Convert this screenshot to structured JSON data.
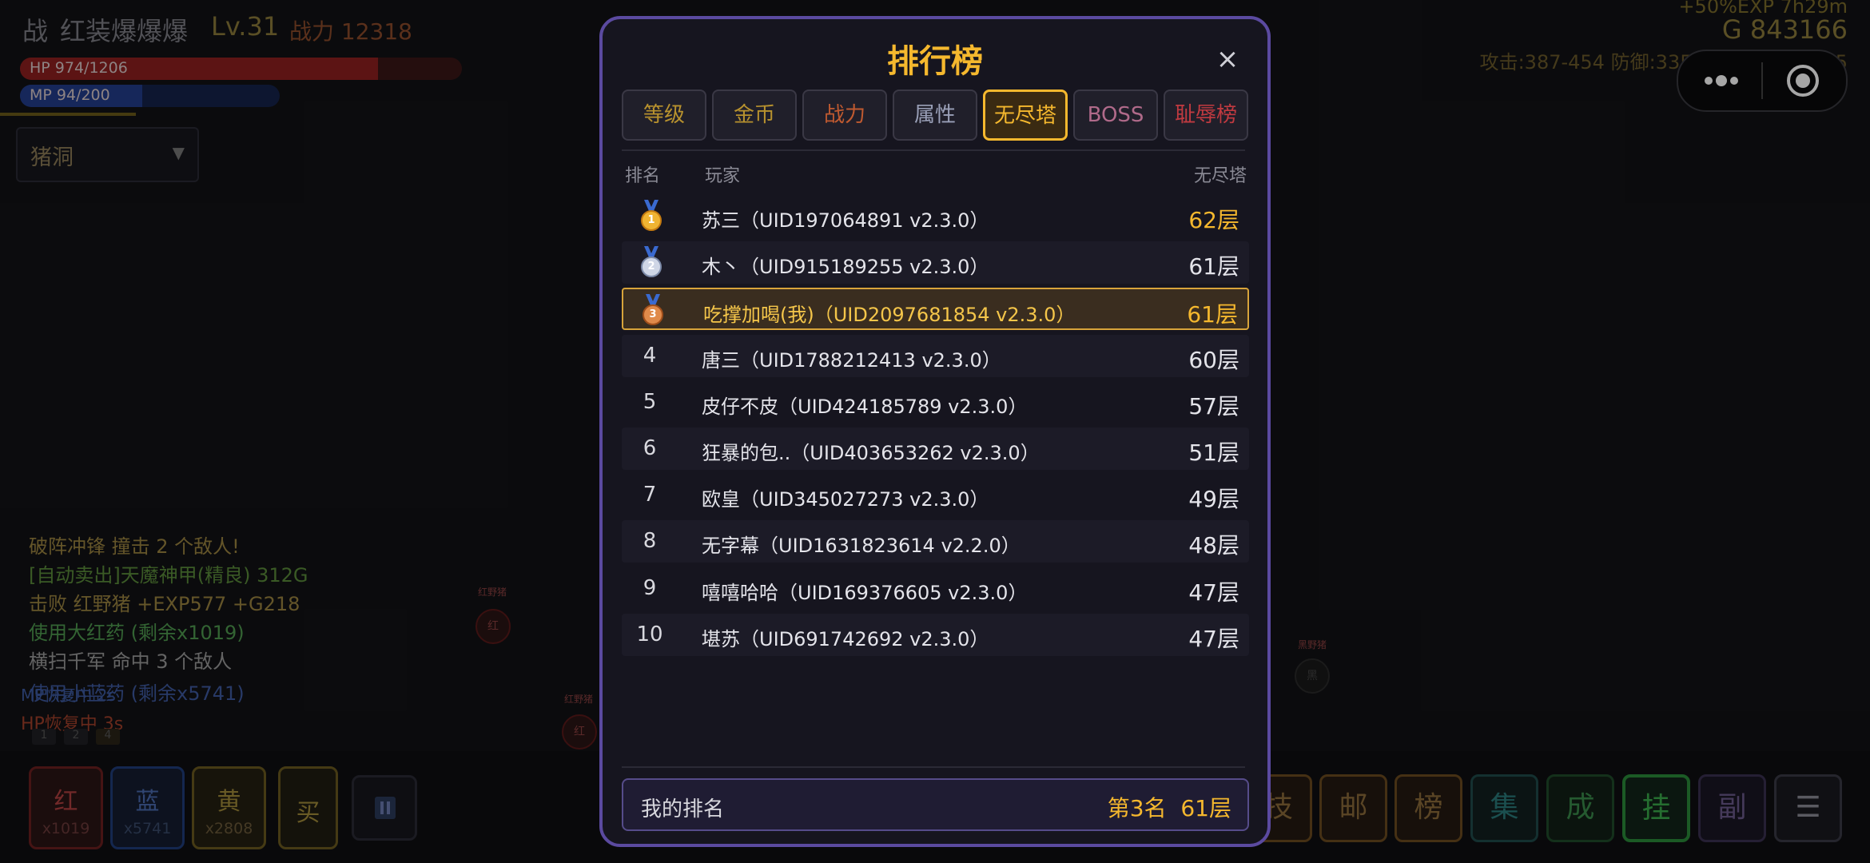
{
  "player": {
    "class_icon": "战",
    "name": "红装爆爆爆",
    "level": "Lv.31",
    "power": "战力 12318",
    "hp": "HP 974/1206",
    "hp_fraction": 0.81,
    "mp": "MP 94/200",
    "mp_fraction": 0.47
  },
  "top_right": {
    "exp_bonus": "+50%EXP 7h29m",
    "gold": "G 843166",
    "stats": "攻击:387-454 防御:335-389 魔御:1..165"
  },
  "zone": {
    "value": "猪洞",
    "arrow": "▼"
  },
  "combat_log": [
    {
      "text": "破阵冲锋 撞击 2 个敌人!",
      "color": "#9a8340"
    },
    {
      "text": "[自动卖出]天魔神甲(精良) 312G",
      "color": "#5a8a3a"
    },
    {
      "text": "击败 红野猪 +EXP577 +G218",
      "color": "#9a8340"
    },
    {
      "text": "使用大红药 (剩余x1019)",
      "color": "#4f9a4f"
    },
    {
      "text": "横扫千军 命中 3 个敌人",
      "color": "#9a9a9a"
    },
    {
      "text": "使用小蓝药 (剩余x5741)",
      "color": "#3e5aa0"
    }
  ],
  "status_text": {
    "mp": "MP恢复中 2s",
    "hp": "HP恢复中 3s"
  },
  "skill_slots": [
    "1",
    "2",
    "4"
  ],
  "enemies": [
    {
      "name": "红野猪",
      "glyph": "红"
    },
    {
      "name": "红野猪",
      "glyph": "红"
    },
    {
      "name": "黑野猪",
      "glyph": "黑"
    }
  ],
  "quick_items": [
    {
      "label": "红",
      "count": "x1019"
    },
    {
      "label": "蓝",
      "count": "x5741"
    },
    {
      "label": "黄",
      "count": "x2808"
    },
    {
      "label": "买",
      "count": ""
    }
  ],
  "pause_icon": "pause-icon",
  "right_menu": [
    "技",
    "邮",
    "榜",
    "集",
    "成",
    "挂",
    "副",
    "☰"
  ],
  "leaderboard": {
    "title": "排行榜",
    "close": "×",
    "tabs": [
      {
        "label": "等级",
        "color": "#b8922e"
      },
      {
        "label": "金币",
        "color": "#b8922e"
      },
      {
        "label": "战力",
        "color": "#c05a30"
      },
      {
        "label": "属性",
        "color": "#9aa0b8"
      },
      {
        "label": "无尽塔",
        "color": "#f5b82e",
        "active": true
      },
      {
        "label": "BOSS",
        "color": "#b06a8a"
      },
      {
        "label": "耻辱榜",
        "color": "#c03a40"
      }
    ],
    "columns": {
      "rank": "排名",
      "player": "玩家",
      "score": "无尽塔"
    },
    "rows": [
      {
        "rank": "1",
        "medal": "gold",
        "player": "苏三（UID197064891 v2.3.0）",
        "score": "62层",
        "highlight_score": true
      },
      {
        "rank": "2",
        "medal": "silver",
        "player": "木丶（UID915189255 v2.3.0）",
        "score": "61层"
      },
      {
        "rank": "3",
        "medal": "bronze",
        "player": "吃撑加喝(我)（UID2097681854 v2.3.0）",
        "score": "61层",
        "me": true
      },
      {
        "rank": "4",
        "player": "唐三（UID1788212413 v2.3.0）",
        "score": "60层"
      },
      {
        "rank": "5",
        "player": "皮仔不皮（UID424185789 v2.3.0）",
        "score": "57层"
      },
      {
        "rank": "6",
        "player": "狂暴的包..（UID403653262 v2.3.0）",
        "score": "51层"
      },
      {
        "rank": "7",
        "player": "欧皇（UID345027273 v2.3.0）",
        "score": "49层"
      },
      {
        "rank": "8",
        "player": "无字幕（UID1631823614 v2.2.0）",
        "score": "48层"
      },
      {
        "rank": "9",
        "player": "嘻嘻哈哈（UID169376605 v2.3.0）",
        "score": "47层"
      },
      {
        "rank": "10",
        "player": "堪苏（UID691742692 v2.3.0）",
        "score": "47层"
      }
    ],
    "my_rank": {
      "label": "我的排名",
      "value": "第3名  61层"
    }
  }
}
